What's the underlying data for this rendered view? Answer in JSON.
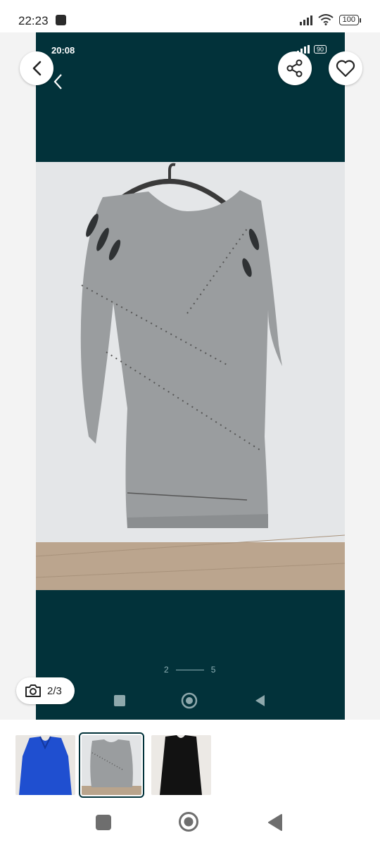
{
  "status_bar": {
    "time": "22:23",
    "battery": "100"
  },
  "photo_status": {
    "time": "20:08",
    "battery": "90"
  },
  "pager": {
    "current": "2",
    "total": "5"
  },
  "counter": {
    "label": "2/3"
  },
  "icons": [
    "back-icon",
    "share-icon",
    "heart-icon",
    "camera-icon",
    "square-icon",
    "circle-icon",
    "triangle-icon"
  ],
  "colors": {
    "photo_background": "#02323a",
    "selected_outline": "#02323a"
  },
  "thumbnails": [
    {
      "name": "blue sweater dress",
      "selected": false
    },
    {
      "name": "grey studded dress",
      "selected": true
    },
    {
      "name": "black dress",
      "selected": false
    }
  ]
}
